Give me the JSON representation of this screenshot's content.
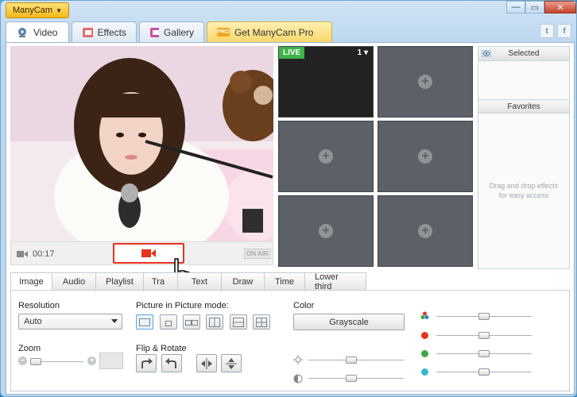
{
  "app": {
    "menu_label": "ManyCam"
  },
  "window_controls": {
    "minimize": "—",
    "maximize": "▭",
    "close": "✕"
  },
  "main_tabs": [
    {
      "label": "Video",
      "icon": "webcam-icon",
      "active": true
    },
    {
      "label": "Effects",
      "icon": "effects-icon",
      "active": false
    },
    {
      "label": "Gallery",
      "icon": "gallery-icon",
      "active": false
    },
    {
      "label": "Get ManyCam Pro",
      "icon": "pro-icon",
      "badge": "PRO",
      "active": false
    }
  ],
  "social": {
    "twitter": "t",
    "facebook": "f"
  },
  "preview": {
    "time": "00:17",
    "on_air": "ON AIR"
  },
  "grid": {
    "live_label": "LIVE",
    "live_channel": "1 ▾",
    "add_symbol": "+"
  },
  "side_panel": {
    "selected_label": "Selected",
    "favorites_label": "Favorites",
    "hint": "Drag and drop effects for easy access"
  },
  "sub_tabs": [
    "Image",
    "Audio",
    "Playlist",
    "Tra",
    "Text",
    "Draw",
    "Time",
    "Lower third"
  ],
  "image_panel": {
    "resolution_label": "Resolution",
    "resolution_value": "Auto",
    "pip_label": "Picture in Picture mode:",
    "color_label": "Color",
    "grayscale_label": "Grayscale",
    "zoom_label": "Zoom",
    "zoom_minus": "−",
    "zoom_plus": "+",
    "flip_label": "Flip & Rotate"
  },
  "colors": {
    "accent_tab_pro": "#f7d76a",
    "live_green": "#3db34a",
    "record_red": "#e8321e"
  },
  "sliders": {
    "brightness": 0.45,
    "contrast": 0.45,
    "saturation": 0.5,
    "red": 0.5,
    "green": 0.5,
    "blue": 0.5
  }
}
